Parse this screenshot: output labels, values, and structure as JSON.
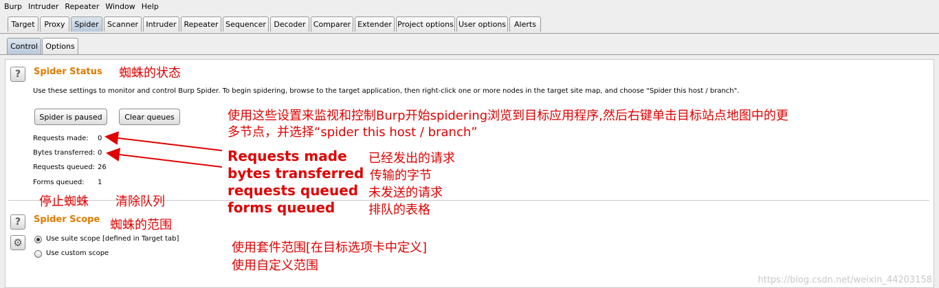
{
  "menu": [
    "Burp",
    "Intruder",
    "Repeater",
    "Window",
    "Help"
  ],
  "main_tabs": [
    "Target",
    "Proxy",
    "Spider",
    "Scanner",
    "Intruder",
    "Repeater",
    "Sequencer",
    "Decoder",
    "Comparer",
    "Extender",
    "Project options",
    "User options",
    "Alerts"
  ],
  "active_main_tab": "Spider",
  "sub_tabs": [
    "Control",
    "Options"
  ],
  "active_sub_tab": "Control",
  "status": {
    "title": "Spider Status",
    "description": "Use these settings to monitor and control Burp Spider. To begin spidering, browse to the target application, then right-click one or more nodes in the target site map, and choose \"Spider this host / branch\".",
    "pause_button": "Spider is paused",
    "clear_button": "Clear queues",
    "stats": [
      {
        "label": "Requests made:",
        "value": "0"
      },
      {
        "label": "Bytes transferred:",
        "value": "0"
      },
      {
        "label": "Requests queued:",
        "value": "26"
      },
      {
        "label": "Forms queued:",
        "value": "1"
      }
    ]
  },
  "scope": {
    "title": "Spider Scope",
    "options": [
      {
        "label": "Use suite scope [defined in Target tab]",
        "checked": true
      },
      {
        "label": "Use custom scope",
        "checked": false
      }
    ]
  },
  "annotations": {
    "status_cn": "蜘蛛的状态",
    "desc_cn_line1": "使用这些设置来监视和控制Burp开始spidering浏览到目标应用程序,然后右键单击目标站点地图中的更",
    "desc_cn_line2": "多节点，并选择“spider this host / branch”",
    "stat_en": [
      "Requests made",
      "bytes transferred",
      "requests queued",
      "forms queued"
    ],
    "stat_cn": [
      "已经发出的请求",
      "传输的字节",
      "未发送的请求",
      "排队的表格"
    ],
    "pause_cn": "停止蜘蛛",
    "clear_cn": "清除队列",
    "scope_cn": "蜘蛛的范围",
    "suite_scope_cn": "使用套件范围[在目标选项卡中定义]",
    "custom_scope_cn": "使用自定义范围"
  },
  "watermark": "https://blog.csdn.net/weixin_44203158",
  "colors": {
    "accent": "#e07a00",
    "annotation": "#e00000"
  }
}
